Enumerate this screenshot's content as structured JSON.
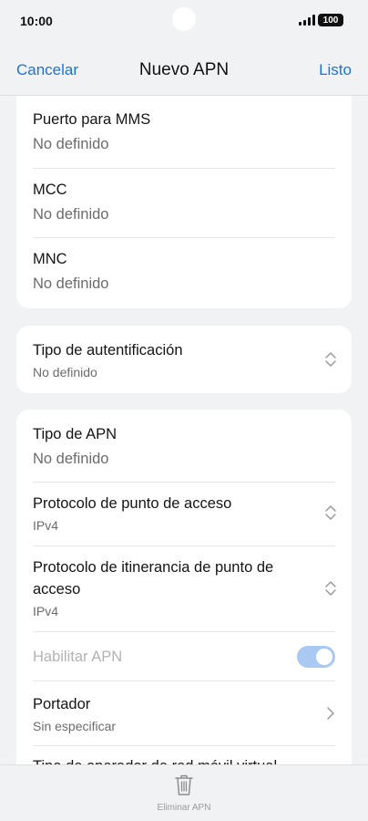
{
  "status_bar": {
    "time": "10:00",
    "battery": "100"
  },
  "nav": {
    "cancel_label": "Cancelar",
    "title": "Nuevo APN",
    "done_label": "Listo"
  },
  "card1": {
    "rows": [
      {
        "title": "Puerto para MMS",
        "value": "No definido"
      },
      {
        "title": "MCC",
        "value": "No definido"
      },
      {
        "title": "MNC",
        "value": "No definido"
      }
    ]
  },
  "card2": {
    "auth_type": {
      "title": "Tipo de autentificación",
      "value": "No definido"
    }
  },
  "card3": {
    "apn_type": {
      "title": "Tipo de APN",
      "value": "No definido"
    },
    "ap_protocol": {
      "title": "Protocolo de punto de acceso",
      "value": "IPv4"
    },
    "roaming_protocol": {
      "title_line1": "Protocolo de itinerancia de punto de",
      "title_line2": "acceso",
      "value": "IPv4"
    },
    "enable_apn": {
      "label": "Habilitar APN",
      "enabled": true
    },
    "bearer": {
      "title": "Portador",
      "value": "Sin especificar"
    },
    "cut_off_row": {
      "title": "Tipo de operador de red móvil virtual"
    }
  },
  "bottom": {
    "delete_label": "Eliminar APN"
  },
  "colors": {
    "accent": "#1a73d9",
    "toggle_on": "#a9c9f2",
    "background": "#f1f2f4"
  }
}
